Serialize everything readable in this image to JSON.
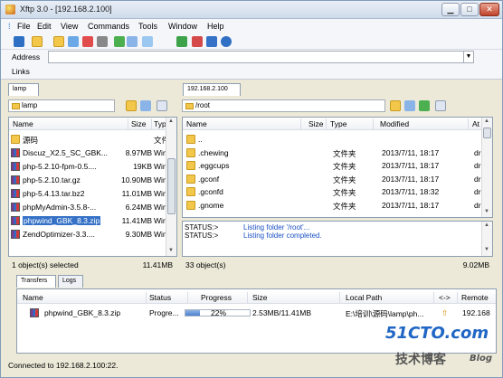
{
  "window": {
    "title": "Xftp 3.0 - [192.168.2.100]"
  },
  "menu": [
    "File",
    "Edit",
    "View",
    "Commands",
    "Tools",
    "Window",
    "Help"
  ],
  "address": {
    "label": "Address",
    "value": ""
  },
  "links": {
    "label": "Links"
  },
  "left_pane": {
    "tab": "lamp",
    "path": "lamp",
    "columns": [
      "Name",
      "Size",
      "Typ"
    ],
    "rows": [
      {
        "name": "源码",
        "size": "",
        "type": "文件",
        "icon": "folder-icon"
      },
      {
        "name": "Discuz_X2.5_SC_GBK...",
        "size": "8.97MB",
        "type": "Win",
        "icon": "zip-icon"
      },
      {
        "name": "php-5.2.10-fpm-0.5....",
        "size": "19KB",
        "type": "Win",
        "icon": "zip-icon"
      },
      {
        "name": "php-5.2.10.tar.gz",
        "size": "10.90MB",
        "type": "Win",
        "icon": "zip-icon"
      },
      {
        "name": "php-5.4.13.tar.bz2",
        "size": "11.01MB",
        "type": "Win",
        "icon": "zip-icon"
      },
      {
        "name": "phpMyAdmin-3.5.8-...",
        "size": "6.24MB",
        "type": "Win",
        "icon": "zip-icon"
      },
      {
        "name": "phpwind_GBK_8.3.zip",
        "size": "11.41MB",
        "type": "Win",
        "icon": "zip-icon",
        "selected": true
      },
      {
        "name": "ZendOptimizer-3.3....",
        "size": "9.30MB",
        "type": "Win",
        "icon": "zip-icon"
      }
    ],
    "status_left": "1 object(s) selected",
    "status_right": "11.41MB"
  },
  "right_pane": {
    "tab": "192.168.2.100",
    "path": "/root",
    "columns": [
      "Name",
      "Size",
      "Type",
      "Modified",
      "At"
    ],
    "rows": [
      {
        "name": "..",
        "size": "",
        "type": "",
        "modified": "",
        "attr": "",
        "icon": "folder-icon"
      },
      {
        "name": ".chewing",
        "size": "",
        "type": "文件夹",
        "modified": "2013/7/11, 18:17",
        "attr": "dr",
        "icon": "folder-icon"
      },
      {
        "name": ".eggcups",
        "size": "",
        "type": "文件夹",
        "modified": "2013/7/11, 18:17",
        "attr": "dr",
        "icon": "folder-icon"
      },
      {
        "name": ".gconf",
        "size": "",
        "type": "文件夹",
        "modified": "2013/7/11, 18:17",
        "attr": "dr",
        "icon": "folder-icon"
      },
      {
        "name": ".gconfd",
        "size": "",
        "type": "文件夹",
        "modified": "2013/7/11, 18:32",
        "attr": "dr",
        "icon": "folder-icon"
      },
      {
        "name": ".gnome",
        "size": "",
        "type": "文件夹",
        "modified": "2013/7/11, 18:17",
        "attr": "dr",
        "icon": "folder-icon"
      }
    ],
    "log": [
      {
        "key": "STATUS:>",
        "msg": "Listing folder '/root'..."
      },
      {
        "key": "STATUS:>",
        "msg": "Listing folder completed."
      }
    ],
    "status_left": "33 object(s)",
    "status_right": "9.02MB"
  },
  "transfers": {
    "tabs": [
      "Transfers",
      "Logs"
    ],
    "columns": [
      "Name",
      "Status",
      "Progress",
      "Size",
      "Local Path",
      "<->",
      "Remote"
    ],
    "rows": [
      {
        "name": "phpwind_GBK_8.3.zip",
        "status": "Progre...",
        "progress_percent": 22,
        "progress_label": "22%",
        "size": "2.53MB/11.41MB",
        "local_path": "E:\\培训\\源码\\lamp\\ph...",
        "remote": "192.168"
      }
    ]
  },
  "statusbar": {
    "text": "Connected to 192.168.2.100:22."
  },
  "watermark": {
    "line1": "51CTO.com",
    "line2": "技术博客",
    "line3": "Blog"
  },
  "colors": {
    "selection": "#3571c6",
    "log_message": "#1a4fc4"
  }
}
